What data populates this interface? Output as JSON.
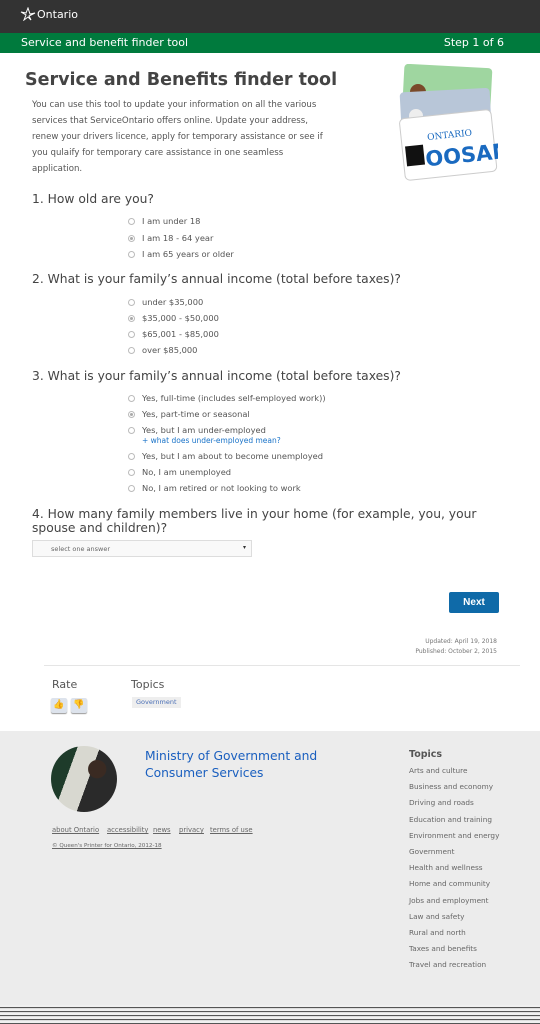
{
  "header": {
    "logo": "Ontario",
    "bar_title": "Service and benefit finder tool",
    "step": "Step 1 of 6"
  },
  "intro": {
    "title": "Service and Benefits finder tool",
    "text": "You can use this tool to update your information on all the various services that ServiceOntario offers online. Update your address, renew your drivers licence, apply for temporary assistance or see if you qulaify for temporary care assistance in one seamless application.",
    "image_text": "OOSAM"
  },
  "questions": [
    {
      "label": "1. How old are you?",
      "options": [
        "I am under 18",
        "I am 18 - 64 year",
        "I am 65 years or older"
      ],
      "selected": 1
    },
    {
      "label": "2. What is your family’s annual income (total before taxes)?",
      "options": [
        "under $35,000",
        "$35,000 - $50,000",
        "$65,001 - $85,000",
        "over $85,000"
      ],
      "selected": 1
    },
    {
      "label": "3. What is your family’s annual income (total before taxes)?",
      "options": [
        "Yes, full-time (includes self-employed work))",
        "Yes, part-time or seasonal",
        "Yes, but I am under-employed",
        "Yes, but I am about to become unemployed",
        "No, I am unemployed",
        "No, I am retired or not looking to work"
      ],
      "selected": 1,
      "help_link": "+ what does under-employed mean?"
    },
    {
      "label": "4. How many family members live in your home (for example, you, your spouse and children)?",
      "select_value": "select one answer"
    }
  ],
  "next_label": "Next",
  "meta": {
    "updated": "Updated: April 19, 2018",
    "published": "Published: October 2, 2015"
  },
  "rate": {
    "title": "Rate"
  },
  "topics": {
    "title": "Topics",
    "tag": "Government"
  },
  "footer": {
    "ministry": "Ministry of Government and Consumer Services",
    "links": [
      "about Ontario",
      "accessibility",
      "news",
      "privacy",
      "terms of use"
    ],
    "copyright": "© Queen's Printer for Ontario, 2012-18",
    "topics_title": "Topics",
    "topics": [
      "Arts and culture",
      "Business and economy",
      "Driving and roads",
      "Education and training",
      "Environment and energy",
      "Government",
      "Health and wellness",
      "Home and community",
      "Jobs and employment",
      "Law and safety",
      "Rural and north",
      "Taxes and benefits",
      "Travel and recreation"
    ]
  },
  "colors": {
    "header": "#333333",
    "green": "#007a3d",
    "button": "#0f6aa8",
    "link": "#1a5fbf"
  }
}
